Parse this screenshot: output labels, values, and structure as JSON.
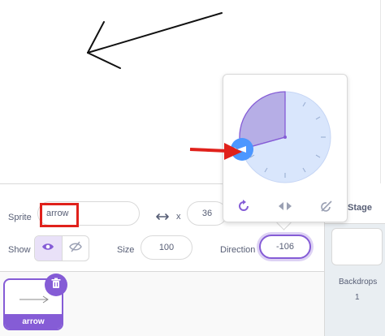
{
  "sprite_info": {
    "sprite_label": "Sprite",
    "sprite_name": "arrow",
    "x_label": "x",
    "x_value": "36",
    "show_label": "Show",
    "size_label": "Size",
    "size_value": "100",
    "direction_label": "Direction",
    "direction_value": "-106"
  },
  "sprite_list": {
    "items": [
      {
        "name": "arrow"
      }
    ]
  },
  "stage_pane": {
    "title": "Stage",
    "backdrops_label": "Backdrops",
    "backdrops_count": "1"
  },
  "direction_popover": {
    "dial_degrees": -106,
    "accent_color": "#855cd6",
    "dial_color": "#4c97ff",
    "rotation_styles": [
      "all-around-rotation-icon",
      "left-right-rotation-icon",
      "dont-rotate-icon"
    ]
  },
  "colors": {
    "annotation_red": "#e0211b",
    "purple": "#855cd6"
  }
}
